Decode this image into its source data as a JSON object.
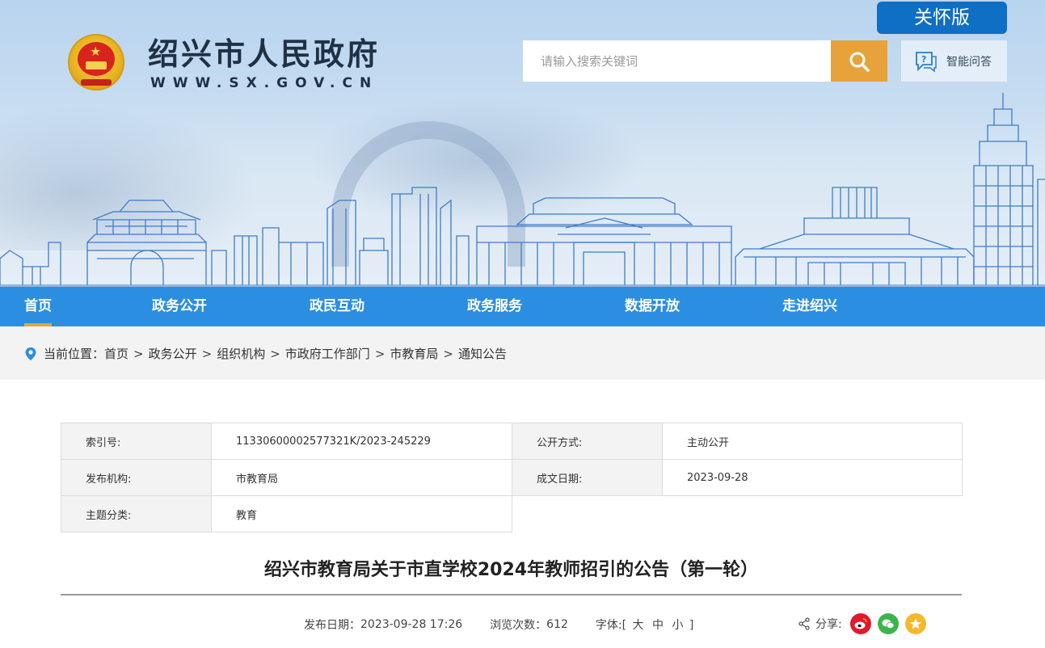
{
  "header": {
    "site_title": "绍兴市人民政府",
    "site_url": "WWW.SX.GOV.CN",
    "care_version_label": "关怀版",
    "search_placeholder": "请输入搜索关键词",
    "qa_label": "智能问答"
  },
  "nav": {
    "items": [
      {
        "label": "首页",
        "active": true
      },
      {
        "label": "政务公开"
      },
      {
        "label": "政民互动"
      },
      {
        "label": "政务服务"
      },
      {
        "label": "数据开放"
      },
      {
        "label": "走进绍兴"
      }
    ]
  },
  "breadcrumb": {
    "prefix": "当前位置：",
    "items": [
      "首页",
      "政务公开",
      "组织机构",
      "市政府工作部门",
      "市教育局",
      "通知公告"
    ],
    "separator": ">"
  },
  "info": {
    "index_label": "索引号:",
    "index_value": "11330600002577321K/2023-245229",
    "open_mode_label": "公开方式:",
    "open_mode_value": "主动公开",
    "publisher_label": "发布机构:",
    "publisher_value": "市教育局",
    "date_label": "成文日期:",
    "date_value": "2023-09-28",
    "topic_label": "主题分类:",
    "topic_value": "教育"
  },
  "article": {
    "title": "绍兴市教育局关于市直学校2024年教师招引的公告（第一轮）",
    "publish_date_label": "发布日期：",
    "publish_date": "2023-09-28 17:26",
    "views_label": "浏览次数：",
    "views": "612",
    "font_label": "字体:[",
    "font_large": "大",
    "font_medium": "中",
    "font_small": "小",
    "font_close": "]"
  },
  "share": {
    "label": "分享:",
    "icons": [
      "weibo-icon",
      "wechat-icon",
      "qzone-icon"
    ]
  },
  "colors": {
    "nav_bg": "#2b8ee1",
    "care_btn": "#0f6fc4",
    "search_btn": "#e7a33a",
    "weibo": "#e6162d",
    "wechat": "#3bb54a",
    "qzone": "#f5b82e"
  }
}
